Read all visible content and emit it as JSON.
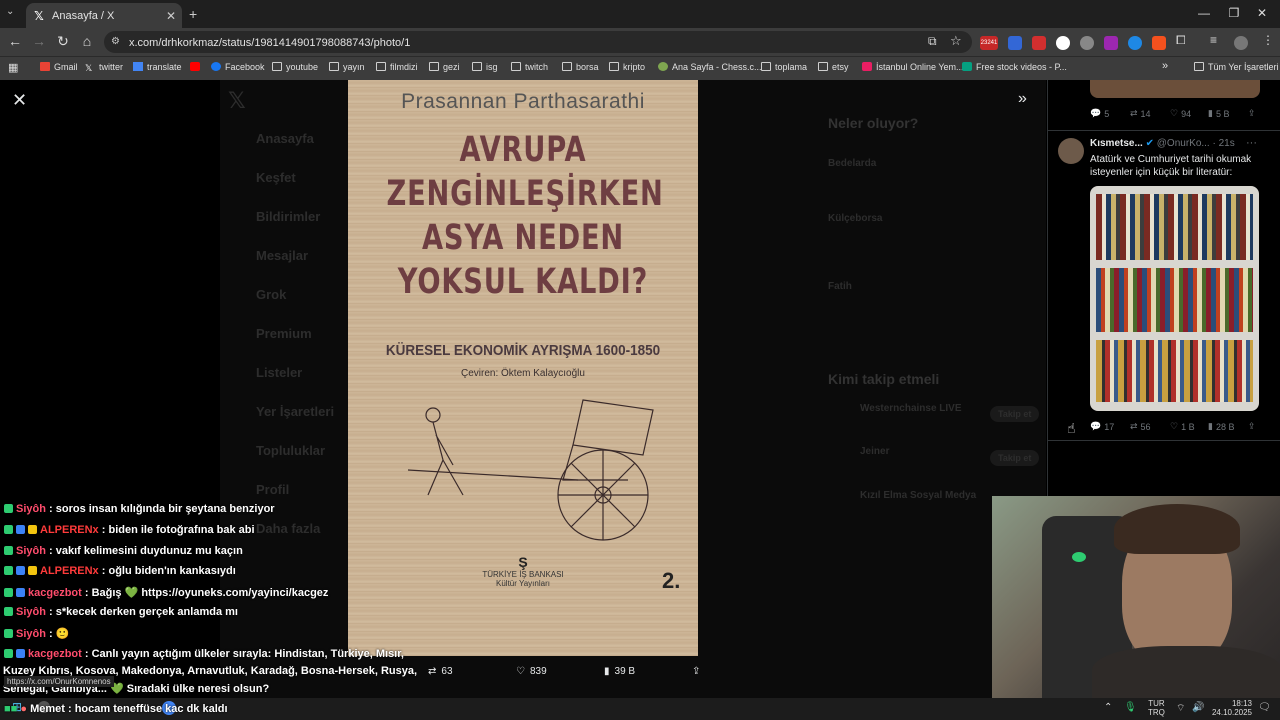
{
  "browser": {
    "tab_title": "Anasayfa / X",
    "url": "x.com/drhkorkmaz/status/1981414901798088743/photo/1",
    "ext_badge": "23241",
    "bookmarks": [
      "Gmail",
      "twitter",
      "translate",
      "Facebook",
      "youtube",
      "yayın",
      "filmdizi",
      "gezi",
      "isg",
      "twitch",
      "borsa",
      "kripto",
      "Ana Sayfa - Chess.c...",
      "toplama",
      "etsy",
      "İstanbul Online Yem...",
      "Free stock videos - P..."
    ],
    "all_bookmarks": "Tüm Yer İşaretleri"
  },
  "x_bg": {
    "nav": [
      "Anasayfa",
      "Keşfet",
      "Bildirimler",
      "Mesajlar",
      "Grok",
      "Premium",
      "Listeler",
      "Yer İşaretleri",
      "Topluluklar",
      "Profil",
      "Daha fazla"
    ],
    "whats_happening": "Neler oluyor?",
    "trends": [
      "Bedelarda",
      "Külçeborsa",
      "Fatih"
    ],
    "who_to_follow": "Kimi takip etmeli",
    "follow_accounts": [
      "Westernchainse LIVE",
      "Jeiner",
      "Kızıl Elma Sosyal Medya"
    ],
    "follow_btn": "Takip et"
  },
  "book": {
    "author": "Prasannan Parthasarathi",
    "title_lines": [
      "AVRUPA",
      "ZENGİNLEŞİRKEN",
      "ASYA NEDEN",
      "YOKSUL KALDI?"
    ],
    "subtitle": "KÜRESEL EKONOMİK AYRIŞMA 1600-1850",
    "translator": "Çeviren: Öktem Kalaycıoğlu",
    "publisher": "TÜRKİYE İŞ BANKASI",
    "publisher_sub": "Kültür Yayınları",
    "edition": "2."
  },
  "post_actions": {
    "retweets": "63",
    "likes": "839",
    "views": "39 B"
  },
  "prev_tweet_stats": {
    "replies": "5",
    "retweets": "14",
    "likes": "94",
    "views": "5 B"
  },
  "tweet": {
    "name": "Kısmetse...",
    "handle": "@OnurKo...",
    "time": "21s",
    "text": "Atatürk ve Cumhuriyet tarihi okumak isteyenler için küçük bir literatür:",
    "replies": "17",
    "retweets": "56",
    "likes": "1 B",
    "views": "28 B"
  },
  "chat": [
    {
      "user": "Siyôh",
      "msg": ": soros insan kılığında bir şeytana benziyor",
      "color": "u1"
    },
    {
      "user": "ALPERENx",
      "msg": ": biden ile fotoğrafına bak abi",
      "color": "u2"
    },
    {
      "user": "Siyôh",
      "msg": ": vakıf kelimesini duydunuz mu kaçın",
      "color": "u1"
    },
    {
      "user": "ALPERENx",
      "msg": ": oğlu biden'ın kankasıydı",
      "color": "u2"
    },
    {
      "user": "kacgezbot",
      "msg": ": Bağış 💚 https://oyuneks.com/yayinci/kacgez",
      "color": "u1"
    },
    {
      "user": "Siyôh",
      "msg": ": s*kecek derken gerçek anlamda mı",
      "color": "u1"
    },
    {
      "user": "Siyôh",
      "msg": ": 🙂",
      "color": "u1"
    },
    {
      "user": "kacgezbot",
      "msg": ": Canlı yayın açtığım ülkeler sırayla: Hindistan, Türkiye, Mısır,",
      "color": "u1"
    }
  ],
  "chat_wrap1": "Kuzey Kıbrıs, Kosova, Makedonya, Arnavutluk, Karadağ, Bosna-Hersek, Rusya,",
  "chat_wrap2": "Senegal, Gambiya... 💚 Sıradaki ülke neresi olsun?",
  "chat_last": {
    "user": "Memet",
    "msg": ": hocam teneffüse kac dk kaldı"
  },
  "status_url": "https://x.com/OnurKomnenos",
  "taskbar": {
    "lang": "TUR",
    "layout": "TRQ",
    "time": "18:13",
    "date": "24.10.2025"
  }
}
